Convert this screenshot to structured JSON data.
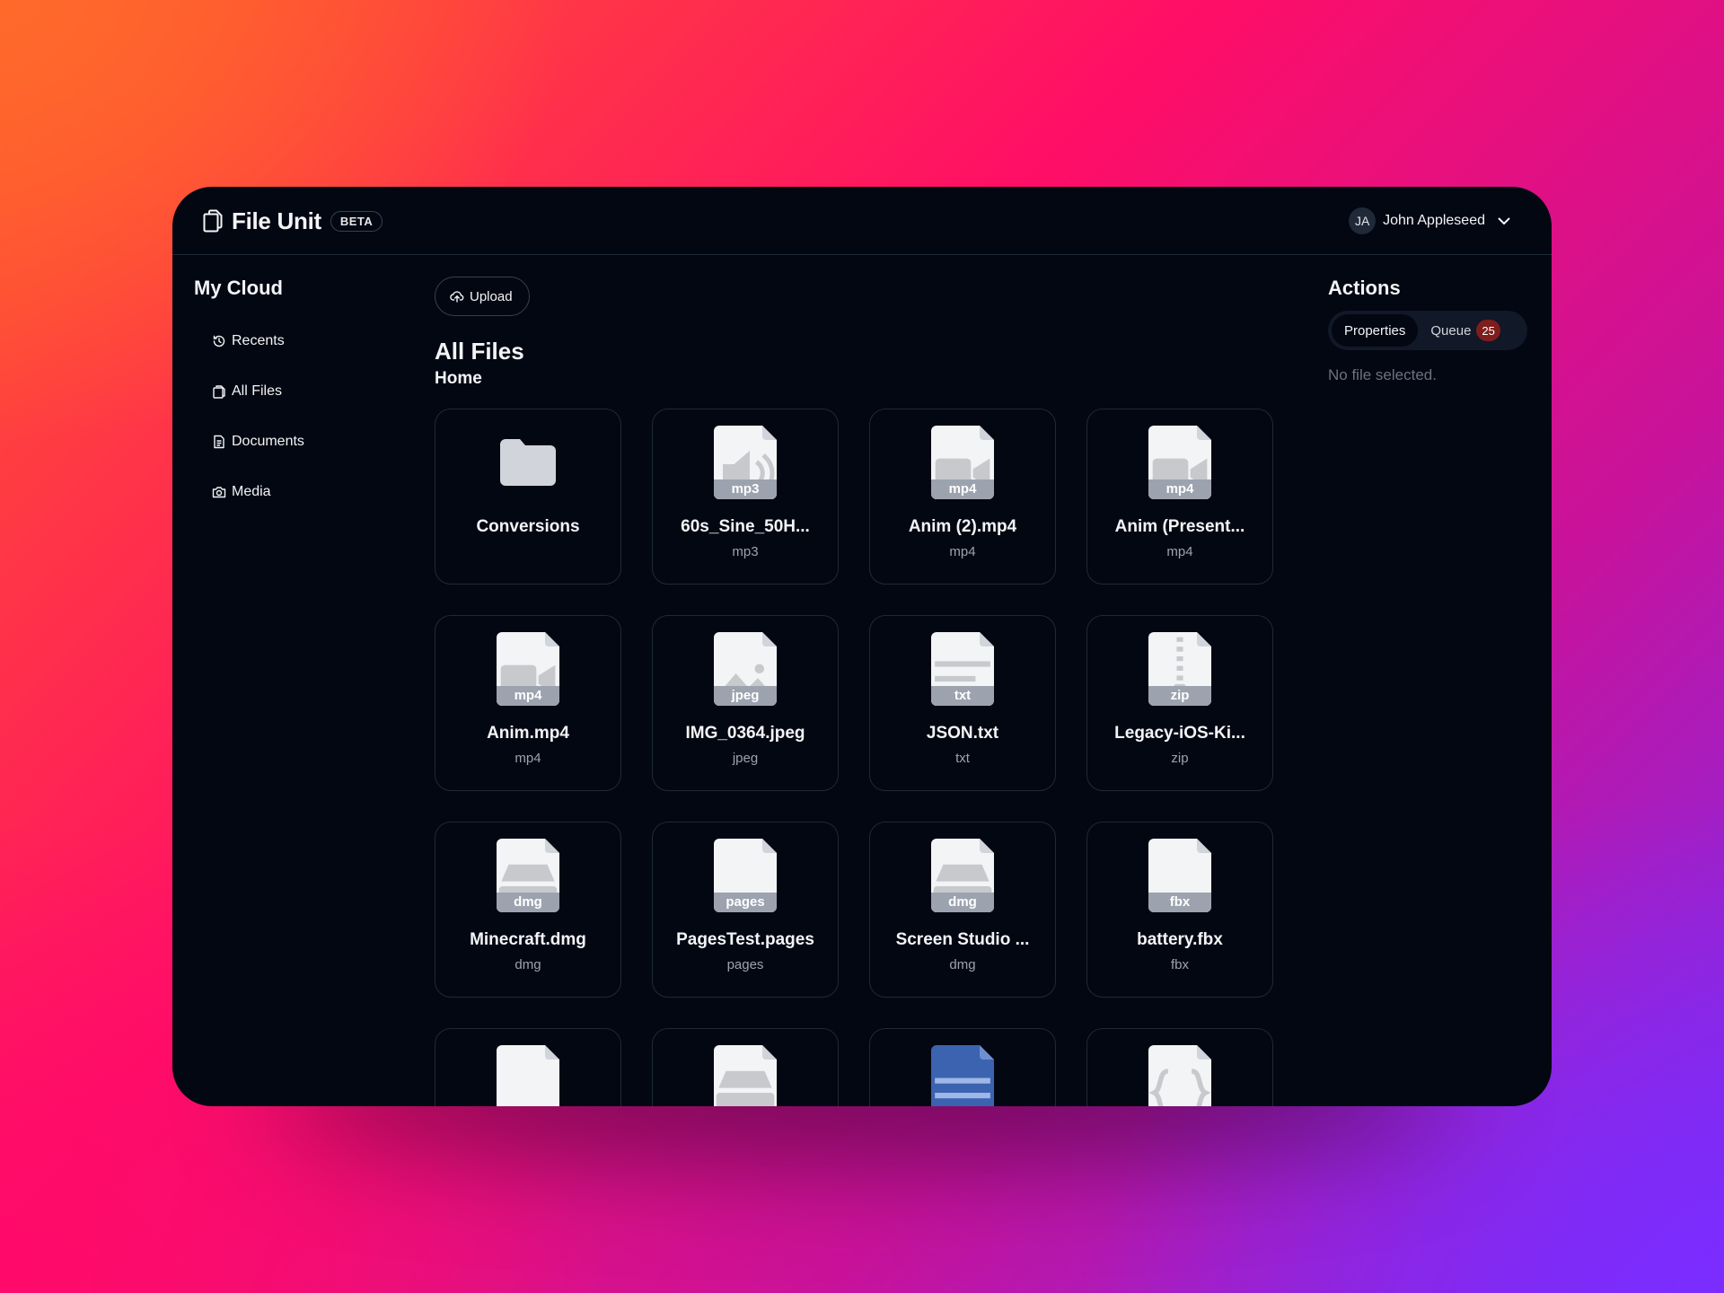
{
  "app": {
    "name": "File Unit",
    "badge": "BETA"
  },
  "user": {
    "initials": "JA",
    "name": "John Appleseed"
  },
  "sidebar": {
    "title": "My Cloud",
    "items": [
      {
        "label": "Recents",
        "icon": "recents-icon"
      },
      {
        "label": "All Files",
        "icon": "files-icon"
      },
      {
        "label": "Documents",
        "icon": "document-icon"
      },
      {
        "label": "Media",
        "icon": "camera-icon"
      }
    ]
  },
  "main": {
    "upload_label": "Upload",
    "title": "All Files",
    "breadcrumb": "Home",
    "files": [
      {
        "name": "Conversions",
        "type": "",
        "kind": "folder"
      },
      {
        "name": "60s_Sine_50H...",
        "type": "mp3",
        "kind": "audio"
      },
      {
        "name": "Anim (2).mp4",
        "type": "mp4",
        "kind": "video"
      },
      {
        "name": "Anim (Present...",
        "type": "mp4",
        "kind": "video"
      },
      {
        "name": "Anim.mp4",
        "type": "mp4",
        "kind": "video"
      },
      {
        "name": "IMG_0364.jpeg",
        "type": "jpeg",
        "kind": "image"
      },
      {
        "name": "JSON.txt",
        "type": "txt",
        "kind": "text"
      },
      {
        "name": "Legacy-iOS-Ki...",
        "type": "zip",
        "kind": "zip"
      },
      {
        "name": "Minecraft.dmg",
        "type": "dmg",
        "kind": "disk"
      },
      {
        "name": "PagesTest.pages",
        "type": "pages",
        "kind": "blank"
      },
      {
        "name": "Screen Studio ...",
        "type": "dmg",
        "kind": "disk"
      },
      {
        "name": "battery.fbx",
        "type": "fbx",
        "kind": "blank"
      }
    ]
  },
  "actions": {
    "title": "Actions",
    "tabs": [
      {
        "label": "Properties"
      },
      {
        "label": "Queue"
      }
    ],
    "queue_count": "25",
    "empty_text": "No file selected."
  },
  "colors": {
    "background": "#030712",
    "border": "#1f2937",
    "badge": "#7f1d1d",
    "file_ext": "#9ca3af"
  }
}
